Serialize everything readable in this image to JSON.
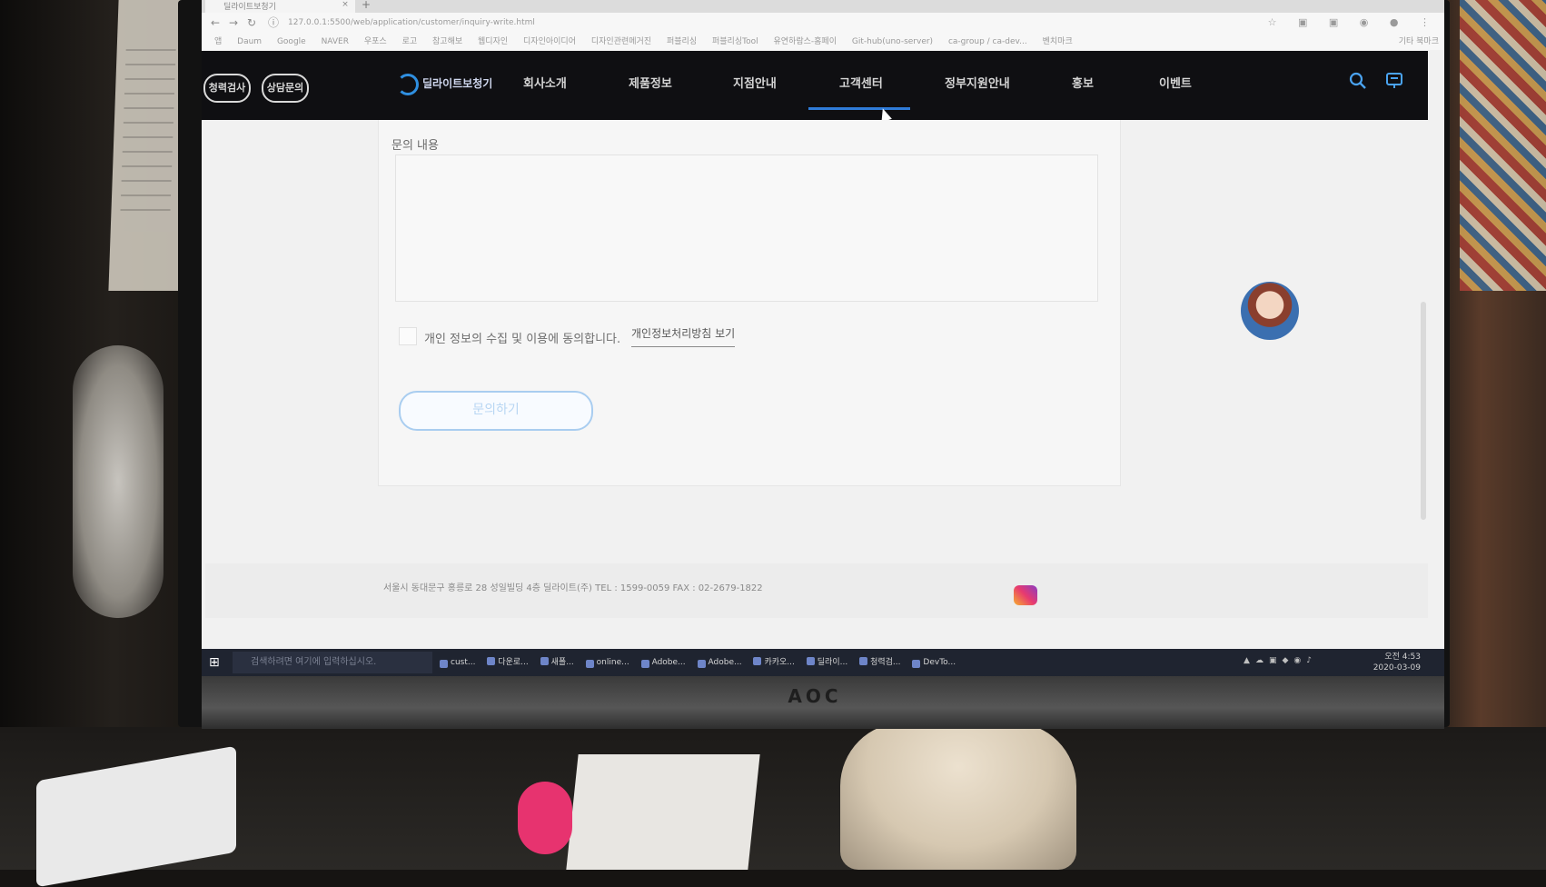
{
  "browser": {
    "tab_title": "딜라이트보청기",
    "tab_close": "×",
    "new_tab": "+",
    "url": "127.0.0.1:5500/web/application/customer/inquiry-write.html",
    "bookmarks": [
      "앱",
      "Daum",
      "Google",
      "NAVER",
      "우포스",
      "로고",
      "참고해보",
      "웹디자인",
      "디자인아이디어",
      "디자인관련메거진",
      "퍼블리싱",
      "퍼블리싱Tool",
      "유연하람스-홈페이",
      "Git-hub(uno-server)",
      "ca-group / ca-dev...",
      "벤치마크"
    ],
    "bookmarks_right": "기타 북마크"
  },
  "site": {
    "pill_buttons": [
      "청력검사",
      "상담문의"
    ],
    "logo": "딜라이트보청기",
    "menu": [
      "회사소개",
      "제품정보",
      "지점안내",
      "고객센터",
      "정부지원안내",
      "홍보",
      "이벤트"
    ],
    "active_menu": "고객센터"
  },
  "form": {
    "content_label": "문의 내용",
    "content_value": "",
    "agree_label": "개인 정보의 수집 및 이용에 동의합니다.",
    "agree_checked": false,
    "policy_link": "개인정보처리방침 보기",
    "submit_label": "문의하기"
  },
  "footer": {
    "address": "서울시 동대문구 홍릉로 28 성일빌딩 4층 딜라이트(주)  TEL : 1599-0059  FAX : 02-2679-1822"
  },
  "taskbar": {
    "search_placeholder": "검색하려면 여기에 입력하십시오.",
    "apps": [
      "cust...",
      "다운로...",
      "새폴...",
      "online...",
      "Adobe...",
      "Adobe...",
      "카카오...",
      "딜라이...",
      "청력검...",
      "DevTo..."
    ],
    "time": "오전 4:53",
    "date": "2020-03-09"
  },
  "monitor_brand": "AOC",
  "colors": {
    "nav_bg": "#0f0f12",
    "accent_blue": "#2f7bd8",
    "submit_border": "#a9cdf0"
  }
}
